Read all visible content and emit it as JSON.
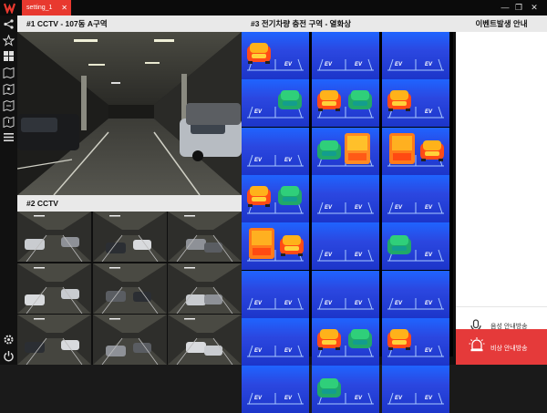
{
  "app": {
    "tab_label": "setting_1",
    "tab_close": "✕",
    "window_controls": [
      "—",
      "❐",
      "✕"
    ]
  },
  "sidebar": {
    "icons": [
      "share-icon",
      "star-icon",
      "grid-icon",
      "map-icon",
      "map-icon",
      "map-icon",
      "map-icon",
      "list-icon"
    ],
    "bottom_icons": [
      "gear-icon",
      "power-icon"
    ]
  },
  "panels": {
    "cctv_main": {
      "title": "#1  CCTV - 107동 A구역"
    },
    "cctv_grid": {
      "title": "#2  CCTV"
    },
    "thermal": {
      "title": "#3  전기차량 충전 구역 - 열화상",
      "ev_label": "EV"
    },
    "event": {
      "title": "이벤트발생 안내",
      "voice_button": "음성 안내방송",
      "emergency_button": "비상 안내방송"
    }
  },
  "colors": {
    "accent_red": "#e8392f",
    "emergency_red": "#e53a3a",
    "thermal_blue": "#2b47e0"
  },
  "thermal_cells": [
    [
      "hot-car",
      "ev",
      "ev"
    ],
    [
      "ev-cool-car",
      "hot-cars",
      "hot-car"
    ],
    [
      "ev",
      "cool-truck",
      "hot-truck"
    ],
    [
      "hot-cool-cars",
      "ev",
      "ev"
    ],
    [
      "hot-truck",
      "ev",
      "cool-car"
    ],
    [
      "ev",
      "ev",
      "ev"
    ],
    [
      "ev",
      "hot-cool-cars",
      "hot-car"
    ],
    [
      "ev",
      "cool-car",
      "ev"
    ]
  ]
}
